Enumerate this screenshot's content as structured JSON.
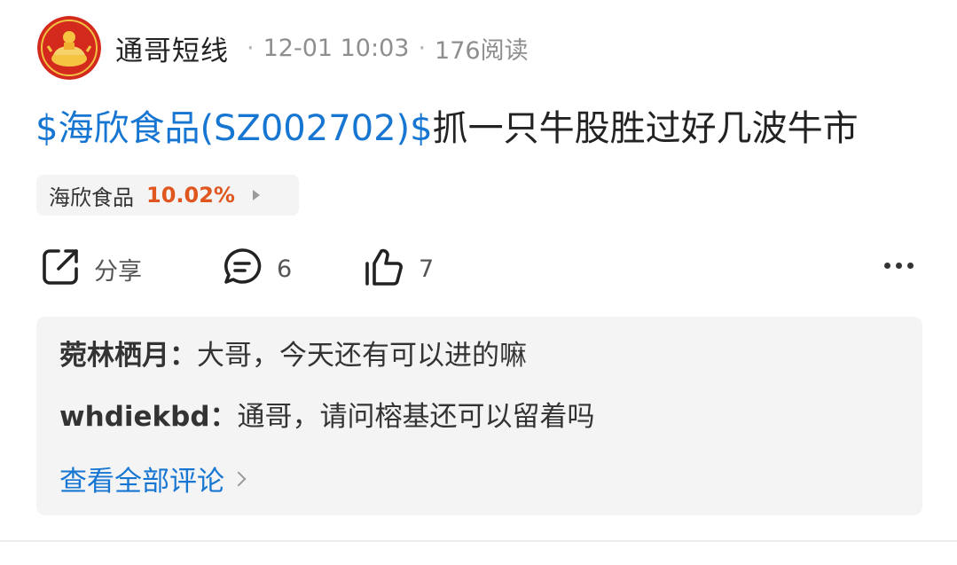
{
  "post": {
    "author": "通哥短线",
    "separator": "·",
    "time": "12-01 10:03",
    "views": "176阅读",
    "title_stock": "$海欣食品(SZ002702)$",
    "title_text": "抓一只牛股胜过好几波牛市"
  },
  "stock_chip": {
    "name": "海欣食品",
    "change": "10.02%",
    "change_color": "#e0561f"
  },
  "actions": {
    "share_label": "分享",
    "comment_count": "6",
    "like_count": "7",
    "icons": [
      "share-icon",
      "comment-icon",
      "like-icon",
      "more-icon"
    ]
  },
  "comments": [
    {
      "user": "菀林栖月：",
      "text": "大哥，今天还有可以进的嘛"
    },
    {
      "user": "whdiekbd：",
      "text": "通哥，请问榕基还可以留着吗"
    }
  ],
  "view_all": "查看全部评论",
  "colors": {
    "link": "#1676d2",
    "up": "#e0561f",
    "panel": "#f4f4f5"
  }
}
